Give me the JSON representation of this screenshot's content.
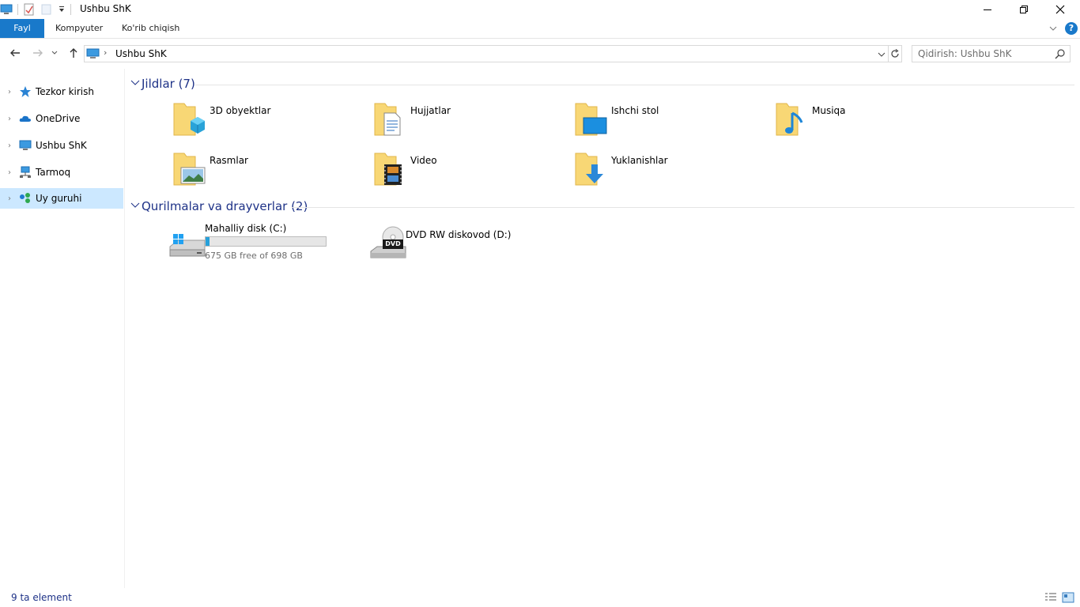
{
  "window": {
    "title": "Ushbu ShK",
    "minimize_label": "—",
    "restore_label": "❐",
    "close_label": "✕"
  },
  "ribbon": {
    "tabs": [
      {
        "label": "Fayl"
      },
      {
        "label": "Kompyuter"
      },
      {
        "label": "Ko'rib chiqish"
      }
    ],
    "help_label": "?"
  },
  "address": {
    "path": "Ushbu ShK",
    "search_placeholder": "Qidirish: Ushbu ShK"
  },
  "nav": {
    "items": [
      {
        "label": "Tezkor kirish",
        "icon": "star-icon"
      },
      {
        "label": "OneDrive",
        "icon": "cloud-icon"
      },
      {
        "label": "Ushbu ShK",
        "icon": "computer-icon"
      },
      {
        "label": "Tarmoq",
        "icon": "network-icon"
      },
      {
        "label": "Uy guruhi",
        "icon": "homegroup-icon",
        "selected": true
      }
    ]
  },
  "folders_group": {
    "title": "Jildlar (7)",
    "items": [
      {
        "label": "3D obyektlar",
        "icon": "3d-objects-folder-icon"
      },
      {
        "label": "Hujjatlar",
        "icon": "documents-folder-icon"
      },
      {
        "label": "Ishchi stol",
        "icon": "desktop-folder-icon"
      },
      {
        "label": "Musiqa",
        "icon": "music-folder-icon"
      },
      {
        "label": "Rasmlar",
        "icon": "pictures-folder-icon"
      },
      {
        "label": "Video",
        "icon": "video-folder-icon"
      },
      {
        "label": "Yuklanishlar",
        "icon": "downloads-folder-icon"
      }
    ]
  },
  "devices_group": {
    "title": "Qurilmalar va drayverlar (2)",
    "drives": [
      {
        "label": "Mahalliy disk (C:)",
        "free_text": "675 GB free of 698 GB",
        "used_fraction": 0.033,
        "icon": "local-disk-icon"
      },
      {
        "label": "DVD RW diskovod (D:)",
        "icon": "dvd-drive-icon",
        "badge": "DVD"
      }
    ]
  },
  "status": {
    "count_text": "9 ta element"
  },
  "colors": {
    "accent": "#1979ca",
    "group_title": "#1e3287",
    "selection": "#cce8ff",
    "folder": "#f8d775",
    "progress": "#26a0da"
  }
}
